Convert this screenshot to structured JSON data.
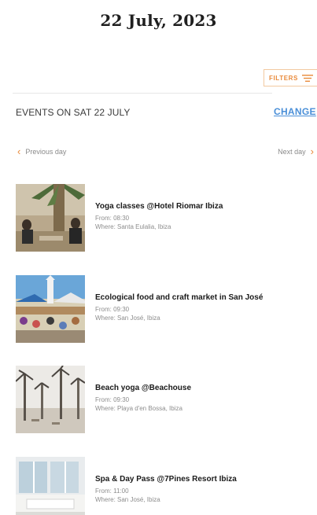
{
  "header": {
    "date_title": "22 July, 2023"
  },
  "filters": {
    "label": "FILTERS",
    "icon": "filter-lines-icon"
  },
  "events_bar": {
    "label": "EVENTS ON SAT 22 JULY",
    "change_label": "CHANGE"
  },
  "day_nav": {
    "previous_label": "Previous day",
    "next_label": "Next day"
  },
  "events": [
    {
      "title": "Yoga classes @Hotel Riomar Ibiza",
      "from": "From: 08:30",
      "where": "Where: Santa Eulalia, Ibiza",
      "image": "yoga-class-photo"
    },
    {
      "title": "Ecological food and craft market in San José",
      "from": "From: 09:30",
      "where": "Where: San José, Ibiza",
      "image": "market-photo"
    },
    {
      "title": "Beach yoga @Beachouse",
      "from": "From: 09:30",
      "where": "Where: Playa d'en Bossa, Ibiza",
      "image": "beach-yoga-photo"
    },
    {
      "title": "Spa & Day Pass @7Pines Resort Ibiza",
      "from": "From: 11:00",
      "where": "Where: San José, Ibiza",
      "image": "spa-photo"
    }
  ],
  "colors": {
    "accent_orange": "#e98a3a",
    "link_blue": "#4a8fd8"
  }
}
